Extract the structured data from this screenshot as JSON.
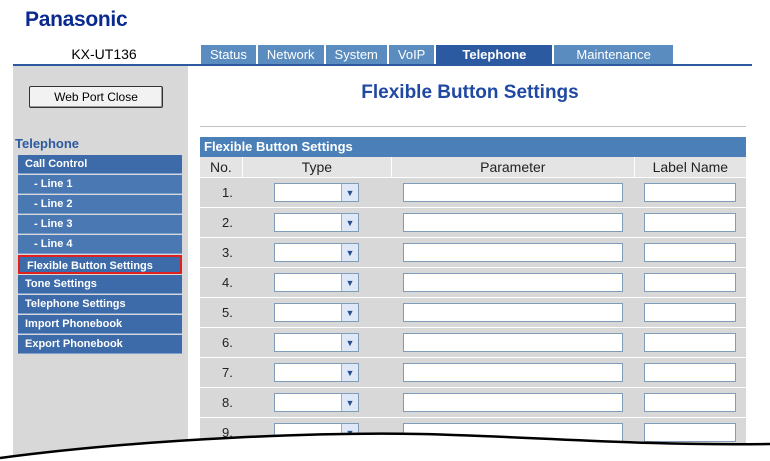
{
  "brand": "Panasonic",
  "model": "KX-UT136",
  "tabs": [
    "Status",
    "Network",
    "System",
    "VoIP",
    "Telephone",
    "Maintenance"
  ],
  "active_tab": "Telephone",
  "web_port_close": "Web Port Close",
  "sidebar": {
    "title": "Telephone",
    "items": [
      {
        "label": "Call Control",
        "sub": false
      },
      {
        "label": "- Line 1",
        "sub": true
      },
      {
        "label": "- Line 2",
        "sub": true
      },
      {
        "label": "- Line 3",
        "sub": true
      },
      {
        "label": "- Line 4",
        "sub": true
      },
      {
        "label": "Flexible Button Settings",
        "sub": false,
        "current": true
      },
      {
        "label": "Tone Settings",
        "sub": false
      },
      {
        "label": "Telephone Settings",
        "sub": false
      },
      {
        "label": "Import Phonebook",
        "sub": false
      },
      {
        "label": "Export Phonebook",
        "sub": false
      }
    ]
  },
  "page_title": "Flexible Button Settings",
  "panel_title": "Flexible Button Settings",
  "columns": {
    "no": "No.",
    "type": "Type",
    "parameter": "Parameter",
    "label": "Label Name"
  },
  "rows": [
    "1.",
    "2.",
    "3.",
    "4.",
    "5.",
    "6.",
    "7.",
    "8.",
    "9."
  ],
  "colors": {
    "brand": "#0b2a8f",
    "tab": "#5b8cc0",
    "tab_active": "#2c5aa0",
    "highlight": "#e0201e"
  }
}
